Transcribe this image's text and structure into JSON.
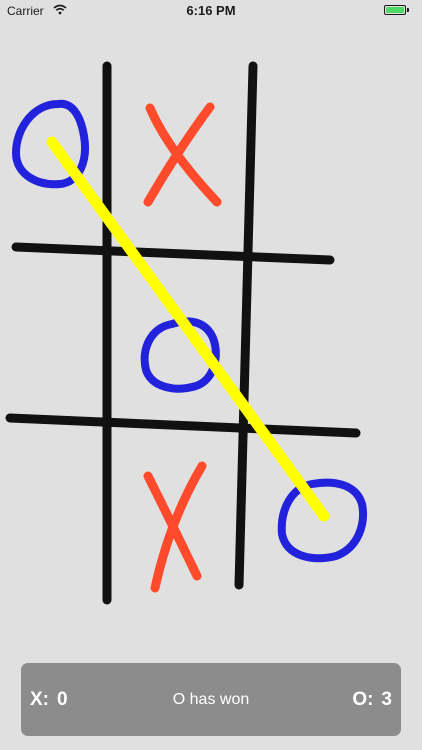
{
  "status_bar": {
    "carrier": "Carrier",
    "time": "6:16 PM",
    "battery_color": "#4cd964"
  },
  "board": {
    "cells": [
      "O",
      "X",
      "",
      "",
      "O",
      "",
      "",
      "X",
      "O"
    ],
    "winning_line": [
      0,
      4,
      8
    ],
    "colors": {
      "grid": "#111111",
      "x": "#ff4b2b",
      "o": "#2222dd",
      "win_line": "#ffff00"
    }
  },
  "score": {
    "x_label": "X:",
    "x_value": "0",
    "result": "O has won",
    "o_label": "O:",
    "o_value": "3"
  }
}
